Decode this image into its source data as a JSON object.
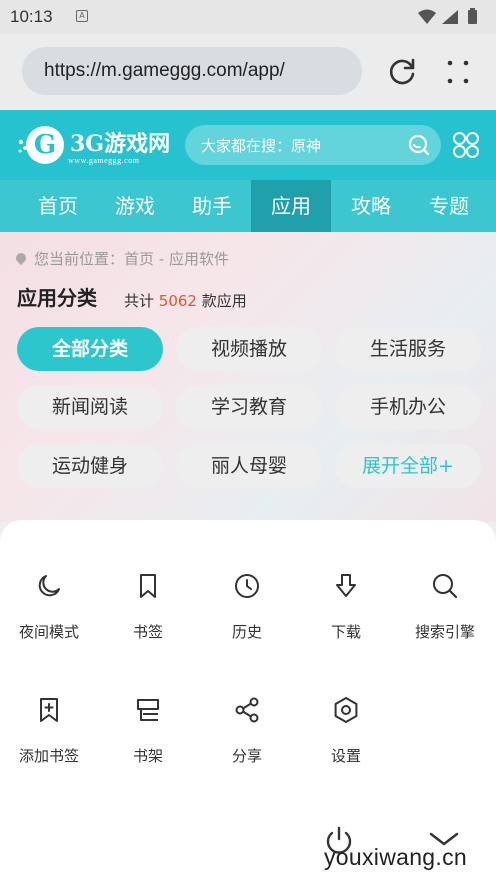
{
  "status_bar": {
    "time": "10:13",
    "notification_icon": "A"
  },
  "browser": {
    "url": "https://m.gameggg.com/app/"
  },
  "site": {
    "logo_name": "3G游戏网",
    "logo_sub": "www.gameggg.com",
    "search_placeholder": "大家都在搜：原神",
    "brand_color": "#27c2cf"
  },
  "nav": {
    "tabs": [
      {
        "label": "首页"
      },
      {
        "label": "游戏"
      },
      {
        "label": "助手"
      },
      {
        "label": "应用",
        "active": true
      },
      {
        "label": "攻略"
      },
      {
        "label": "专题"
      }
    ]
  },
  "page": {
    "breadcrumb": "您当前位置：首页 - 应用软件",
    "section_title": "应用分类",
    "count_prefix": "共计",
    "count_value": "5062",
    "count_suffix": "款应用",
    "categories": [
      {
        "label": "全部分类",
        "active": true
      },
      {
        "label": "视频播放"
      },
      {
        "label": "生活服务"
      },
      {
        "label": "新闻阅读"
      },
      {
        "label": "学习教育"
      },
      {
        "label": "手机办公"
      },
      {
        "label": "运动健身"
      },
      {
        "label": "丽人母婴"
      },
      {
        "label": "展开全部+"
      }
    ]
  },
  "menu": {
    "items": [
      {
        "label": "夜间模式",
        "icon": "moon-icon"
      },
      {
        "label": "书签",
        "icon": "bookmark-icon"
      },
      {
        "label": "历史",
        "icon": "clock-icon"
      },
      {
        "label": "下载",
        "icon": "download-icon"
      },
      {
        "label": "搜索引擎",
        "icon": "search-icon"
      },
      {
        "label": "添加书签",
        "icon": "add-bookmark-icon"
      },
      {
        "label": "书架",
        "icon": "bookshelf-icon"
      },
      {
        "label": "分享",
        "icon": "share-icon"
      },
      {
        "label": "设置",
        "icon": "settings-icon"
      }
    ]
  },
  "watermark": "youxiwang.cn"
}
